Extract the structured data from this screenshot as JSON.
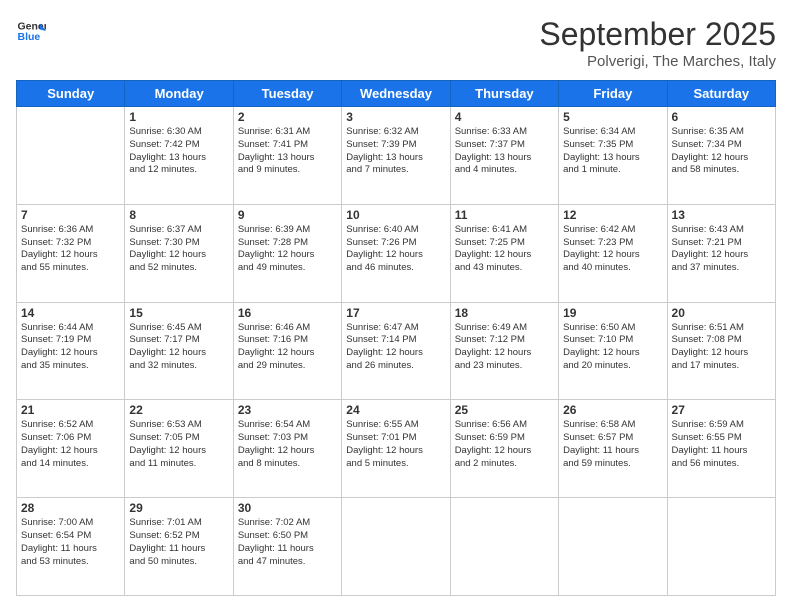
{
  "logo": {
    "line1": "General",
    "line2": "Blue"
  },
  "title": "September 2025",
  "subtitle": "Polverigi, The Marches, Italy",
  "days_of_week": [
    "Sunday",
    "Monday",
    "Tuesday",
    "Wednesday",
    "Thursday",
    "Friday",
    "Saturday"
  ],
  "weeks": [
    [
      {
        "day": "",
        "info": ""
      },
      {
        "day": "1",
        "info": "Sunrise: 6:30 AM\nSunset: 7:42 PM\nDaylight: 13 hours\nand 12 minutes."
      },
      {
        "day": "2",
        "info": "Sunrise: 6:31 AM\nSunset: 7:41 PM\nDaylight: 13 hours\nand 9 minutes."
      },
      {
        "day": "3",
        "info": "Sunrise: 6:32 AM\nSunset: 7:39 PM\nDaylight: 13 hours\nand 7 minutes."
      },
      {
        "day": "4",
        "info": "Sunrise: 6:33 AM\nSunset: 7:37 PM\nDaylight: 13 hours\nand 4 minutes."
      },
      {
        "day": "5",
        "info": "Sunrise: 6:34 AM\nSunset: 7:35 PM\nDaylight: 13 hours\nand 1 minute."
      },
      {
        "day": "6",
        "info": "Sunrise: 6:35 AM\nSunset: 7:34 PM\nDaylight: 12 hours\nand 58 minutes."
      }
    ],
    [
      {
        "day": "7",
        "info": "Sunrise: 6:36 AM\nSunset: 7:32 PM\nDaylight: 12 hours\nand 55 minutes."
      },
      {
        "day": "8",
        "info": "Sunrise: 6:37 AM\nSunset: 7:30 PM\nDaylight: 12 hours\nand 52 minutes."
      },
      {
        "day": "9",
        "info": "Sunrise: 6:39 AM\nSunset: 7:28 PM\nDaylight: 12 hours\nand 49 minutes."
      },
      {
        "day": "10",
        "info": "Sunrise: 6:40 AM\nSunset: 7:26 PM\nDaylight: 12 hours\nand 46 minutes."
      },
      {
        "day": "11",
        "info": "Sunrise: 6:41 AM\nSunset: 7:25 PM\nDaylight: 12 hours\nand 43 minutes."
      },
      {
        "day": "12",
        "info": "Sunrise: 6:42 AM\nSunset: 7:23 PM\nDaylight: 12 hours\nand 40 minutes."
      },
      {
        "day": "13",
        "info": "Sunrise: 6:43 AM\nSunset: 7:21 PM\nDaylight: 12 hours\nand 37 minutes."
      }
    ],
    [
      {
        "day": "14",
        "info": "Sunrise: 6:44 AM\nSunset: 7:19 PM\nDaylight: 12 hours\nand 35 minutes."
      },
      {
        "day": "15",
        "info": "Sunrise: 6:45 AM\nSunset: 7:17 PM\nDaylight: 12 hours\nand 32 minutes."
      },
      {
        "day": "16",
        "info": "Sunrise: 6:46 AM\nSunset: 7:16 PM\nDaylight: 12 hours\nand 29 minutes."
      },
      {
        "day": "17",
        "info": "Sunrise: 6:47 AM\nSunset: 7:14 PM\nDaylight: 12 hours\nand 26 minutes."
      },
      {
        "day": "18",
        "info": "Sunrise: 6:49 AM\nSunset: 7:12 PM\nDaylight: 12 hours\nand 23 minutes."
      },
      {
        "day": "19",
        "info": "Sunrise: 6:50 AM\nSunset: 7:10 PM\nDaylight: 12 hours\nand 20 minutes."
      },
      {
        "day": "20",
        "info": "Sunrise: 6:51 AM\nSunset: 7:08 PM\nDaylight: 12 hours\nand 17 minutes."
      }
    ],
    [
      {
        "day": "21",
        "info": "Sunrise: 6:52 AM\nSunset: 7:06 PM\nDaylight: 12 hours\nand 14 minutes."
      },
      {
        "day": "22",
        "info": "Sunrise: 6:53 AM\nSunset: 7:05 PM\nDaylight: 12 hours\nand 11 minutes."
      },
      {
        "day": "23",
        "info": "Sunrise: 6:54 AM\nSunset: 7:03 PM\nDaylight: 12 hours\nand 8 minutes."
      },
      {
        "day": "24",
        "info": "Sunrise: 6:55 AM\nSunset: 7:01 PM\nDaylight: 12 hours\nand 5 minutes."
      },
      {
        "day": "25",
        "info": "Sunrise: 6:56 AM\nSunset: 6:59 PM\nDaylight: 12 hours\nand 2 minutes."
      },
      {
        "day": "26",
        "info": "Sunrise: 6:58 AM\nSunset: 6:57 PM\nDaylight: 11 hours\nand 59 minutes."
      },
      {
        "day": "27",
        "info": "Sunrise: 6:59 AM\nSunset: 6:55 PM\nDaylight: 11 hours\nand 56 minutes."
      }
    ],
    [
      {
        "day": "28",
        "info": "Sunrise: 7:00 AM\nSunset: 6:54 PM\nDaylight: 11 hours\nand 53 minutes."
      },
      {
        "day": "29",
        "info": "Sunrise: 7:01 AM\nSunset: 6:52 PM\nDaylight: 11 hours\nand 50 minutes."
      },
      {
        "day": "30",
        "info": "Sunrise: 7:02 AM\nSunset: 6:50 PM\nDaylight: 11 hours\nand 47 minutes."
      },
      {
        "day": "",
        "info": ""
      },
      {
        "day": "",
        "info": ""
      },
      {
        "day": "",
        "info": ""
      },
      {
        "day": "",
        "info": ""
      }
    ]
  ]
}
